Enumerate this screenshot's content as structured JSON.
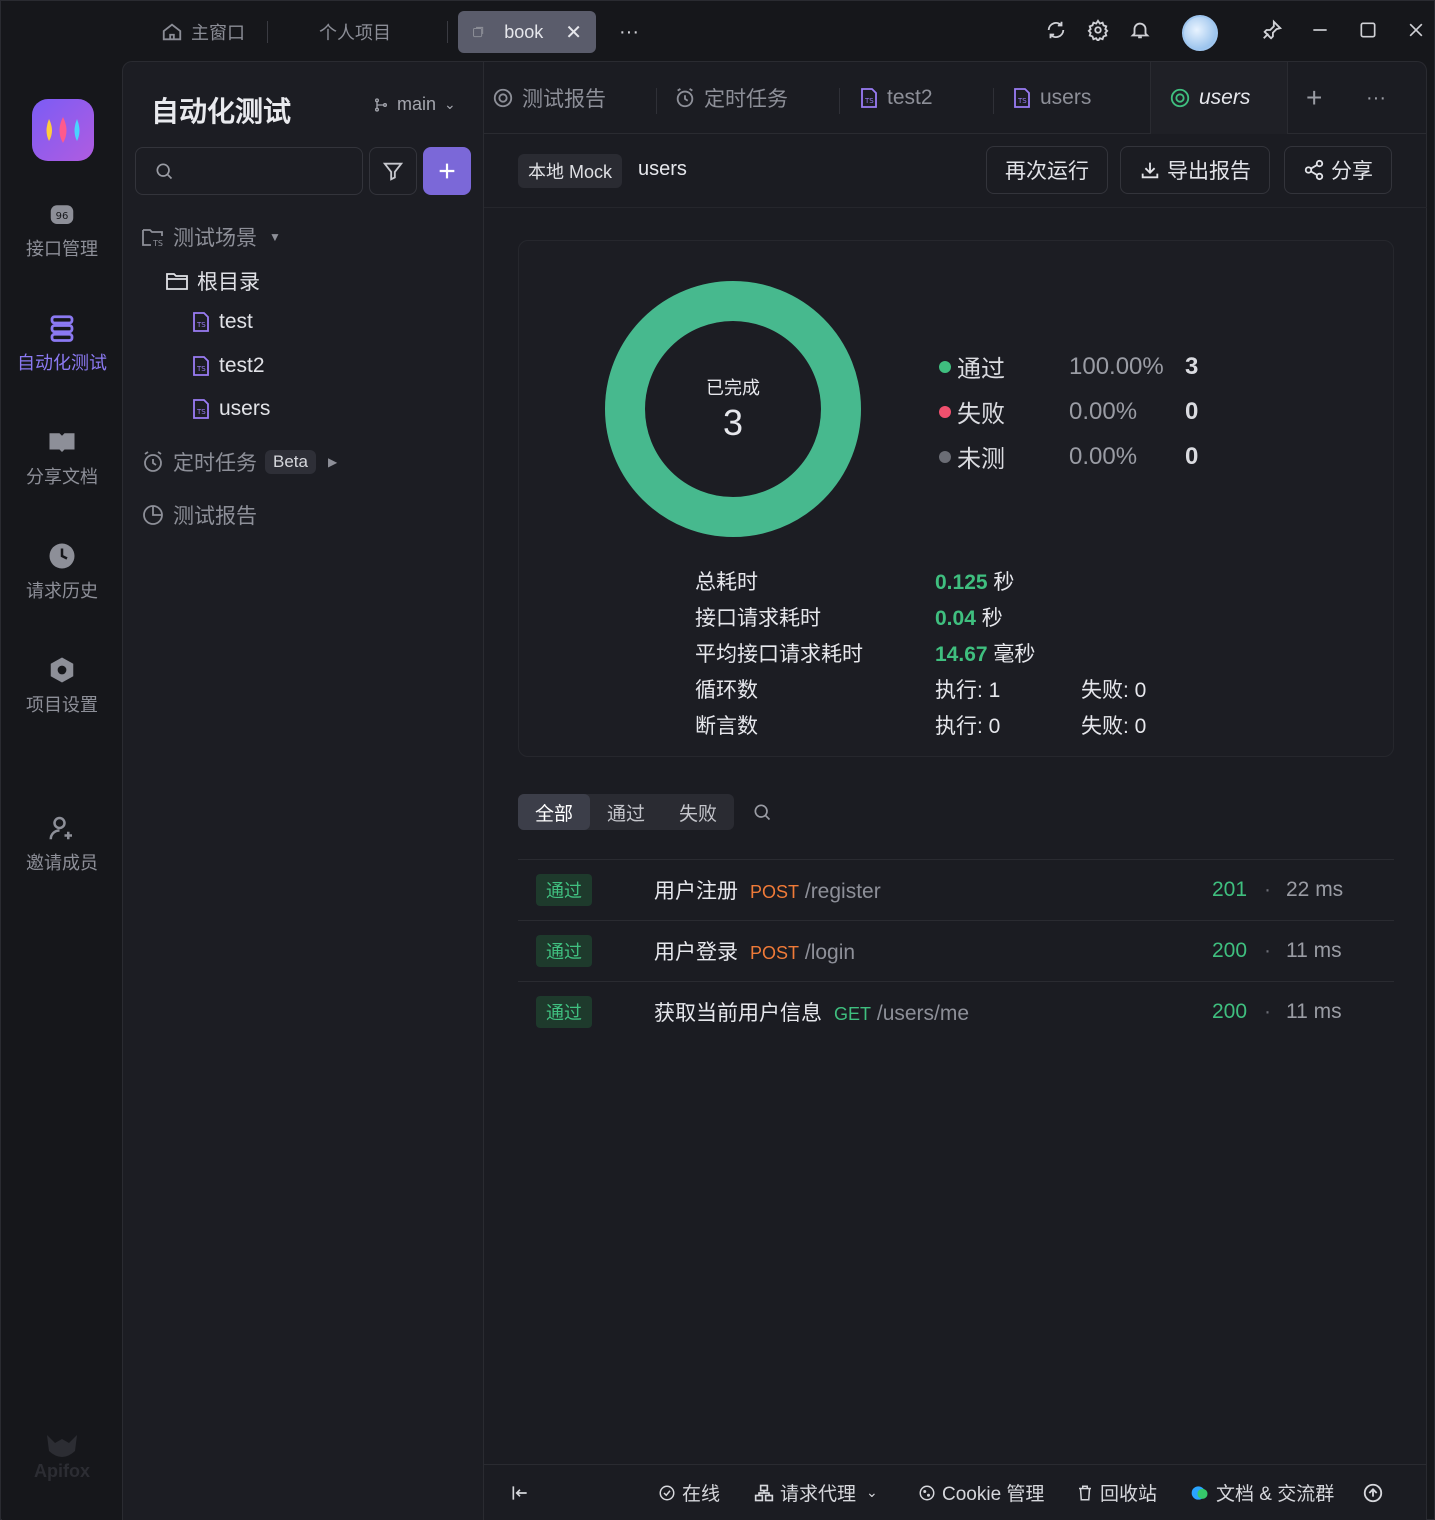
{
  "window_tabs": [
    {
      "label": "主窗口",
      "icon": "home-icon"
    },
    {
      "label": "个人项目"
    },
    {
      "label": "book",
      "icon": "window-icon",
      "active": true
    }
  ],
  "more_label": "···",
  "rail": {
    "items": [
      {
        "label": "接口管理",
        "icon": "api-icon"
      },
      {
        "label": "自动化测试",
        "icon": "automation-icon",
        "active": true
      },
      {
        "label": "分享文档",
        "icon": "book-icon"
      },
      {
        "label": "请求历史",
        "icon": "clock-icon"
      },
      {
        "label": "项目设置",
        "icon": "settings-icon"
      },
      {
        "label": "邀请成员",
        "icon": "add-user-icon"
      }
    ],
    "brand": "Apifox"
  },
  "panel": {
    "title": "自动化测试",
    "branch": "main",
    "tree": {
      "scenarios": "测试场景",
      "root": "根目录",
      "files": [
        "test",
        "test2",
        "users"
      ],
      "schedule": "定时任务",
      "beta": "Beta",
      "reports": "测试报告"
    }
  },
  "tabs": [
    {
      "label": "测试报告",
      "icon": "report-icon"
    },
    {
      "label": "定时任务",
      "icon": "alarm-icon"
    },
    {
      "label": "test2",
      "icon": "ts-file-icon"
    },
    {
      "label": "users",
      "icon": "ts-file-icon"
    },
    {
      "label": "users",
      "icon": "run-icon",
      "active": true
    }
  ],
  "toolbar": {
    "env": "本地 Mock",
    "name": "users",
    "rerun": "再次运行",
    "export": "导出报告",
    "share": "分享"
  },
  "summary": {
    "done_label": "已完成",
    "done_count": "3",
    "legend": [
      {
        "label": "通过",
        "pct": "100.00%",
        "count": "3",
        "color": "#3fbf7f"
      },
      {
        "label": "失败",
        "pct": "0.00%",
        "count": "0",
        "color": "#f0506e"
      },
      {
        "label": "未测",
        "pct": "0.00%",
        "count": "0",
        "color": "#6b6d75"
      }
    ],
    "stats": {
      "total_time_label": "总耗时",
      "total_time": "0.125",
      "total_time_unit": "秒",
      "req_time_label": "接口请求耗时",
      "req_time": "0.04",
      "req_time_unit": "秒",
      "avg_label": "平均接口请求耗时",
      "avg": "14.67",
      "avg_unit": "毫秒",
      "loops_label": "循环数",
      "loops_exec": "执行: 1",
      "loops_fail": "失败: 0",
      "assert_label": "断言数",
      "assert_exec": "执行: 0",
      "assert_fail": "失败: 0"
    },
    "pass_ratio": 1.0
  },
  "filter": {
    "all": "全部",
    "pass": "通过",
    "fail": "失败"
  },
  "results": [
    {
      "status": "通过",
      "name": "用户注册",
      "method": "POST",
      "path": "/register",
      "code": "201",
      "dot": "·",
      "time": "22 ms"
    },
    {
      "status": "通过",
      "name": "用户登录",
      "method": "POST",
      "path": "/login",
      "code": "200",
      "dot": "·",
      "time": "11 ms"
    },
    {
      "status": "通过",
      "name": "获取当前用户信息",
      "method": "GET",
      "path": "/users/me",
      "code": "200",
      "dot": "·",
      "time": "11 ms"
    }
  ],
  "statusbar": {
    "online": "在线",
    "proxy": "请求代理",
    "cookie": "Cookie 管理",
    "trash": "回收站",
    "docs": "文档 & 交流群"
  }
}
